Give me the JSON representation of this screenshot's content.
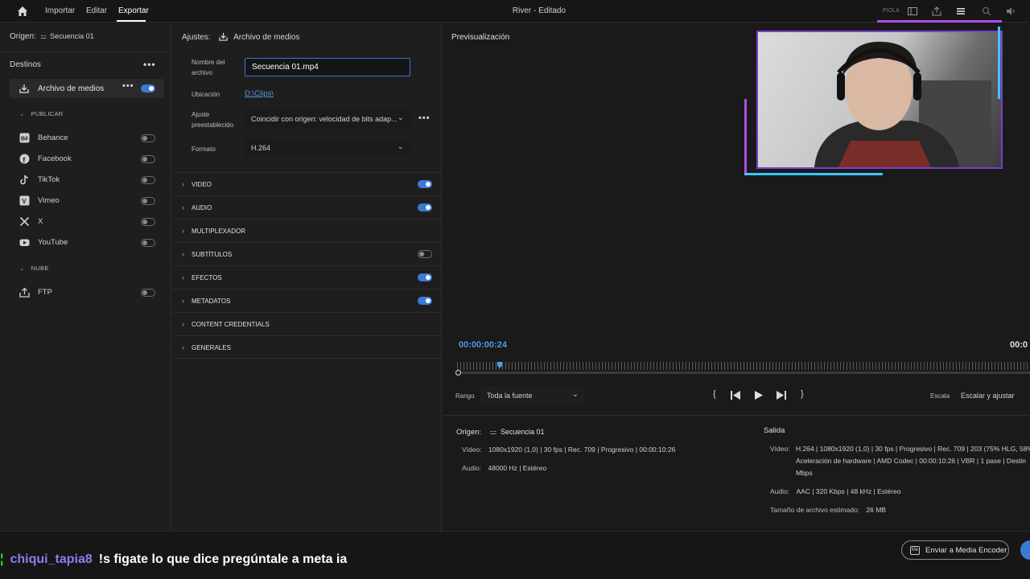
{
  "topbar": {
    "menu": [
      "Importar",
      "Editar",
      "Exportar"
    ],
    "active_tab": "Exportar",
    "title": "River - Editado",
    "workspace": "PIOLA"
  },
  "left": {
    "origin_label": "Origen:",
    "origin_value": "Secuencia 01",
    "destinations_title": "Destinos",
    "media_file": {
      "label": "Archivo de medios",
      "enabled": true
    },
    "publish_section": "PUBLICAR",
    "publish_items": [
      {
        "label": "Behance",
        "icon": "behance-icon",
        "enabled": false
      },
      {
        "label": "Facebook",
        "icon": "facebook-icon",
        "enabled": false
      },
      {
        "label": "TikTok",
        "icon": "tiktok-icon",
        "enabled": false
      },
      {
        "label": "Vimeo",
        "icon": "vimeo-icon",
        "enabled": false
      },
      {
        "label": "X",
        "icon": "x-icon",
        "enabled": false
      },
      {
        "label": "YouTube",
        "icon": "youtube-icon",
        "enabled": false
      }
    ],
    "cloud_section": "NUBE",
    "cloud_items": [
      {
        "label": "FTP",
        "icon": "upload-icon",
        "enabled": false
      }
    ]
  },
  "settings": {
    "title": "Ajustes:",
    "subtitle": "Archivo de medios",
    "filename_label_1": "Nombre del",
    "filename_label_2": "archivo",
    "filename_value": "Secuencia 01.mp4",
    "location_label": "Ubicación",
    "location_value": "D:\\Clips\\",
    "preset_label_1": "Ajuste",
    "preset_label_2": "preestablecido",
    "preset_value": "Coincidir con origen: velocidad de bits adap...",
    "format_label": "Formato",
    "format_value": "H.264",
    "sections": [
      {
        "label": "VIDEO",
        "toggle": "on"
      },
      {
        "label": "AUDIO",
        "toggle": "on"
      },
      {
        "label": "MULTIPLEXADOR",
        "toggle": "none"
      },
      {
        "label": "SUBTÍTULOS",
        "toggle": "off"
      },
      {
        "label": "EFECTOS",
        "toggle": "on"
      },
      {
        "label": "METADATOS",
        "toggle": "on"
      },
      {
        "label": "CONTENT CREDENTIALS",
        "toggle": "none"
      },
      {
        "label": "GENERALES",
        "toggle": "none"
      }
    ]
  },
  "preview": {
    "title": "Previsualización",
    "timecode": "00:00:00:24",
    "timecode_end": "00:0",
    "range_label": "Rango",
    "range_value": "Toda la fuente",
    "scale_label": "Escala",
    "scale_value": "Escalar y ajustar",
    "source": {
      "title": "Origen:",
      "sequence": "Secuencia 01",
      "video_label": "Vídeo:",
      "video_value": "1080x1920 (1,0)  |  30 fps  |  Rec. 709  |  Progresivo  |  00:00:10:26",
      "audio_label": "Audio:",
      "audio_value": "48000 Hz  |  Estéreo"
    },
    "output": {
      "title": "Salida",
      "video_label": "Vídeo:",
      "video_line1": "H.264  |  1080x1920 (1,0)  |  30 fps  |  Progresivo  |  Rec. 709  |  203 (75% HLG, 58%",
      "video_line2": "Aceleración de hardware  |  AMD Codec  |  00:00:10:26  |  VBR  |  1 pase  |  Destin",
      "video_line3": "Mbps",
      "audio_label": "Audio:",
      "audio_value": "AAC  |  320 Kbps  |  48 kHz  |  Estéreo",
      "size_label": "Tamaño de archivo estimado:",
      "size_value": "26 MB"
    }
  },
  "bottom": {
    "chat_user": "chiqui_tapia8",
    "chat_message": "!s figate lo que dice pregúntale a meta ia",
    "encoder_button": "Enviar a Media Encoder"
  },
  "colors": {
    "accent": "#3a7bd5",
    "link": "#4a9be8",
    "chat_user": "#8f7cf0"
  }
}
